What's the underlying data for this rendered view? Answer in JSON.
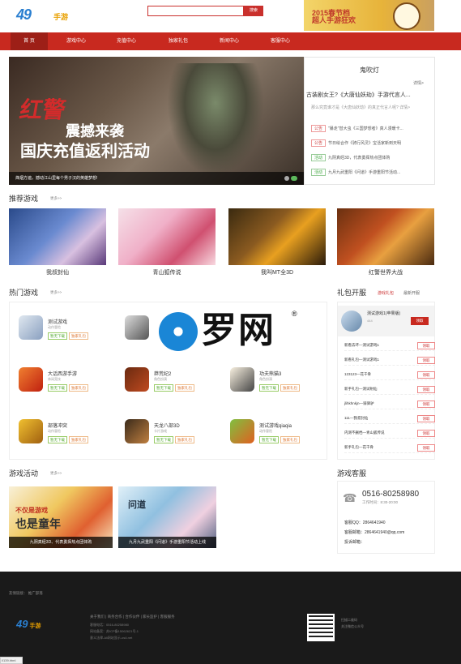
{
  "header": {
    "logo_num": "49",
    "logo_text": "手游",
    "search_placeholder": "",
    "search_button": "搜索",
    "banner_text_1": "2015春节档",
    "banner_text_2": "超人手游狂欢"
  },
  "nav": {
    "items": [
      "首 页",
      "游戏中心",
      "充值中心",
      "独家礼包",
      "新闻中心",
      "客服中心"
    ]
  },
  "hero": {
    "red_text": "红警",
    "line1": "震撼来袭",
    "line2": "国庆充值返利活动",
    "caption": "烽烟方遍，撼动江山里每个男子汉的英雄梦想!"
  },
  "news": {
    "title": "鬼吹灯",
    "more": "详情>",
    "lead": "古装剧女王?《大唐仙妖劫》手游代言人...",
    "sub": "那么究竟谁才是《大唐仙妖劫》的真正代言人呢? 详情>",
    "items": [
      {
        "tag": "公告",
        "text": "\"暴走\"替大虫《三国梦想者》真人漫暖卡..."
      },
      {
        "tag": "公告",
        "text": "节日绘合作《骑行风灵》宝活家新到天明"
      },
      {
        "tag": "活动",
        "text": "九阴真经3D，代表勇挥热点团体购"
      },
      {
        "tag": "活动",
        "text": "九月九武重阳《问道》手游重阳节活动..."
      }
    ]
  },
  "recommend": {
    "title": "推荐游戏",
    "more": "更多>>",
    "games": [
      "我叔封仙",
      "青山狐传说",
      "我叫MT全3D",
      "红警世界大战"
    ]
  },
  "hot": {
    "title": "热门游戏",
    "more": "更多>>",
    "download": "暂无下载",
    "gift": "独家礼包",
    "games": [
      {
        "name": "测试游戏",
        "cat": "动作冒险"
      },
      {
        "name": "",
        "cat": ""
      },
      {
        "name": "",
        "cat": ""
      },
      {
        "name": "大话西游手游",
        "cat": "休闲竞技"
      },
      {
        "name": "莽荒纪2",
        "cat": "角色扮演"
      },
      {
        "name": "功夫熊猫3",
        "cat": "角色扮演"
      },
      {
        "name": "部落冲突",
        "cat": "动作冒险"
      },
      {
        "name": "天龙八部3D",
        "cat": "卡片游戏"
      },
      {
        "name": "测试游戏qiaqia",
        "cat": "动作冒险"
      }
    ]
  },
  "watermark": {
    "text": "罗网",
    "mark": "®"
  },
  "giftpack": {
    "title": "礼包开服",
    "tab1": "游戏礼包",
    "tab2": "最新开服",
    "top_name": "测试游戏1(苹果版)",
    "top_sub": "444",
    "claim": "领取",
    "items": [
      "新看去环—测试游戏1",
      "新看礼包—测试游戏1",
      "123123—花千骨",
      "新手礼包—测试射仙",
      "jlihkhnkjn—骑驿驴",
      "111—我叔封仙",
      "内测不删档—青山狐传说",
      "新手礼包—花千骨"
    ]
  },
  "activity": {
    "title": "游戏活动",
    "more": "更多>>",
    "cap1": "九阴真经3D、代表勇挥热点团体购",
    "cap2": "九月九武重阳《问道》手游重阳节活动上线",
    "art1_a": "不仅是游戏",
    "art1_b": "也是童年",
    "art2": "问道"
  },
  "service": {
    "title": "游戏客服",
    "phone": "0516-80258980",
    "hours": "工作时间：8:30-20:00",
    "qq": "客服QQ：2864641940",
    "mail": "客服邮箱：2864641940@qq.com",
    "complain": "投诉邮箱："
  },
  "footer": {
    "links": "友情链接：    推广部落",
    "nav": "关于我们  |  商务合作  |  合作伙伴  |  家长监护  |  客服服务",
    "info1": "客服电话：0516-80258980",
    "info2": "网站备案：苏ICP备15062621号-1",
    "info3": "意义法律-Ali网站显示-os4.net",
    "qr1": "扫描二维码",
    "qr2": "关注微信公众号",
    "logo_num": "49",
    "logo_text": "手游"
  },
  "status": {
    "text": "l/139.html"
  }
}
